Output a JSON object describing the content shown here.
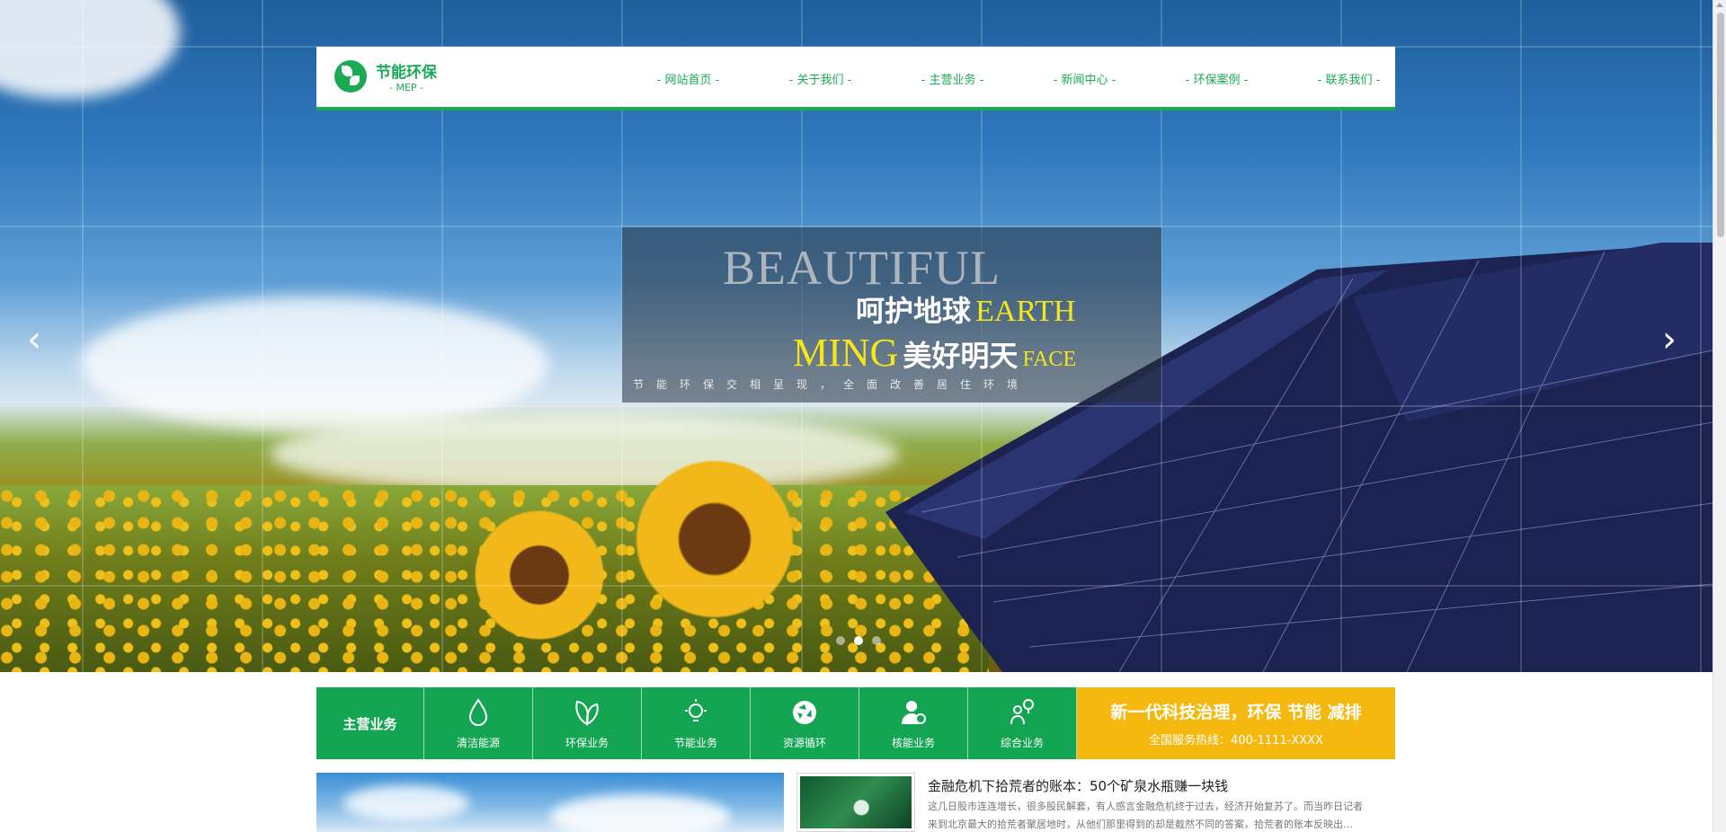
{
  "header": {
    "logo_title": "节能环保",
    "logo_sub": "- MEP -",
    "nav": [
      {
        "label": "- 网站首页 -"
      },
      {
        "label": "- 关于我们 -"
      },
      {
        "label": "- 主营业务 -"
      },
      {
        "label": "- 新闻中心 -"
      },
      {
        "label": "- 环保案例 -"
      },
      {
        "label": "- 联系我们 -"
      }
    ]
  },
  "hero": {
    "big_en": "BEAUTIFUL",
    "line1_cn": "呵护地球",
    "line1_en": "EARTH",
    "line2_en": "MING",
    "line2_cn": "美好明天",
    "line2_en_small": "FACE",
    "sub": "节能环保交相呈现，全面改善居住环境",
    "prev_arrow": "‹",
    "next_arrow": "›",
    "slide_count": 3,
    "active_slide": 1
  },
  "service": {
    "title": "主营业务",
    "items": [
      {
        "label": "清洁能源",
        "icon": "water-drop-icon"
      },
      {
        "label": "环保业务",
        "icon": "leaf-icon"
      },
      {
        "label": "节能业务",
        "icon": "light-bulb-icon"
      },
      {
        "label": "资源循环",
        "icon": "recycle-icon"
      },
      {
        "label": "核能业务",
        "icon": "person-check-icon"
      },
      {
        "label": "综合业务",
        "icon": "person-idea-icon"
      }
    ],
    "promo_title": "新一代科技治理，环保 节能 减排",
    "promo_phone": "全国服务热线：400-1111-XXXX"
  },
  "news": {
    "title": "金融危机下拾荒者的账本：50个矿泉水瓶赚一块钱",
    "desc": "这几日股市连连增长，很多股民解套，有人感言金融危机终于过去，经济开始复苏了。而当昨日记者来到北京最大的拾荒者聚居地时，从他们那里得到的却是截然不同的答案，拾荒者的账本反映出…"
  },
  "colors": {
    "brand_green": "#13a552",
    "promo_yellow": "#f5b80f",
    "slogan_yellow": "#f5e51a"
  }
}
